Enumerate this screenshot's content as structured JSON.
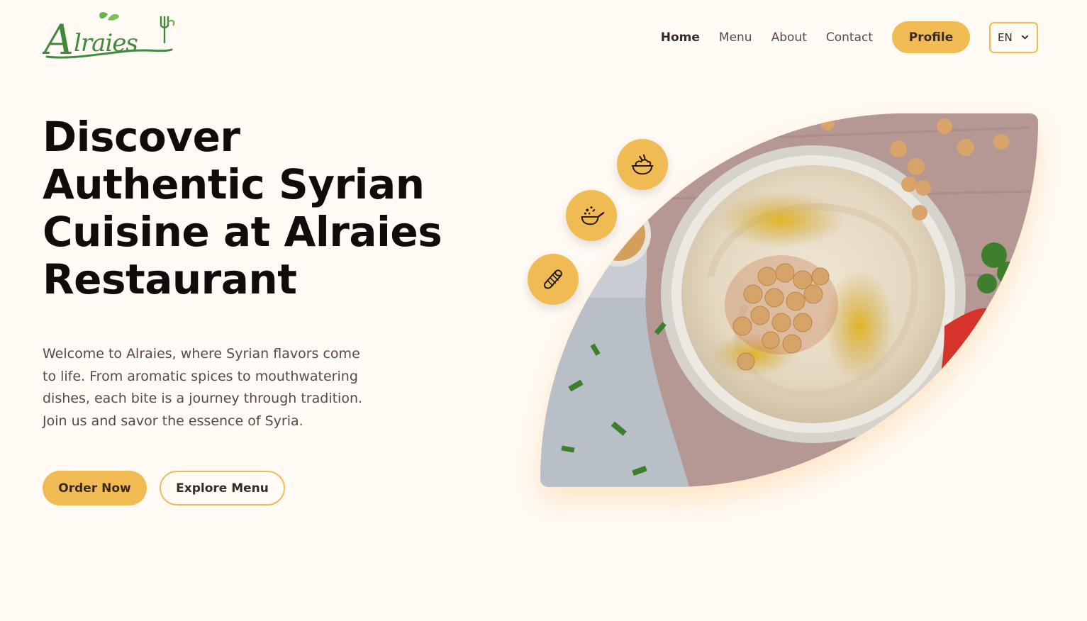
{
  "brand": {
    "logo_text": "Alraies",
    "accent": "#f0bb52",
    "logo_green": "#3f8a3c"
  },
  "nav": {
    "items": [
      {
        "label": "Home",
        "active": true
      },
      {
        "label": "Menu",
        "active": false
      },
      {
        "label": "About",
        "active": false
      },
      {
        "label": "Contact",
        "active": false
      }
    ],
    "profile_label": "Profile",
    "language": {
      "selected": "EN",
      "icon": "chevron-down-icon"
    }
  },
  "hero": {
    "title_lines": [
      "Discover",
      "Authentic Syrian",
      "Cuisine at Alraies",
      "Restaurant"
    ],
    "description": "Welcome to Alraies, where Syrian flavors come to life. From aromatic spices to mouthwatering dishes, each bite is a journey through tradition. Join us and savor the essence of Syria.",
    "primary_cta": "Order Now",
    "secondary_cta": "Explore Menu",
    "image": {
      "subject": "hummus-bowl-photo"
    },
    "feature_icons": [
      "food-bowl-icon",
      "cooking-pan-icon",
      "wrap-sandwich-icon"
    ]
  }
}
